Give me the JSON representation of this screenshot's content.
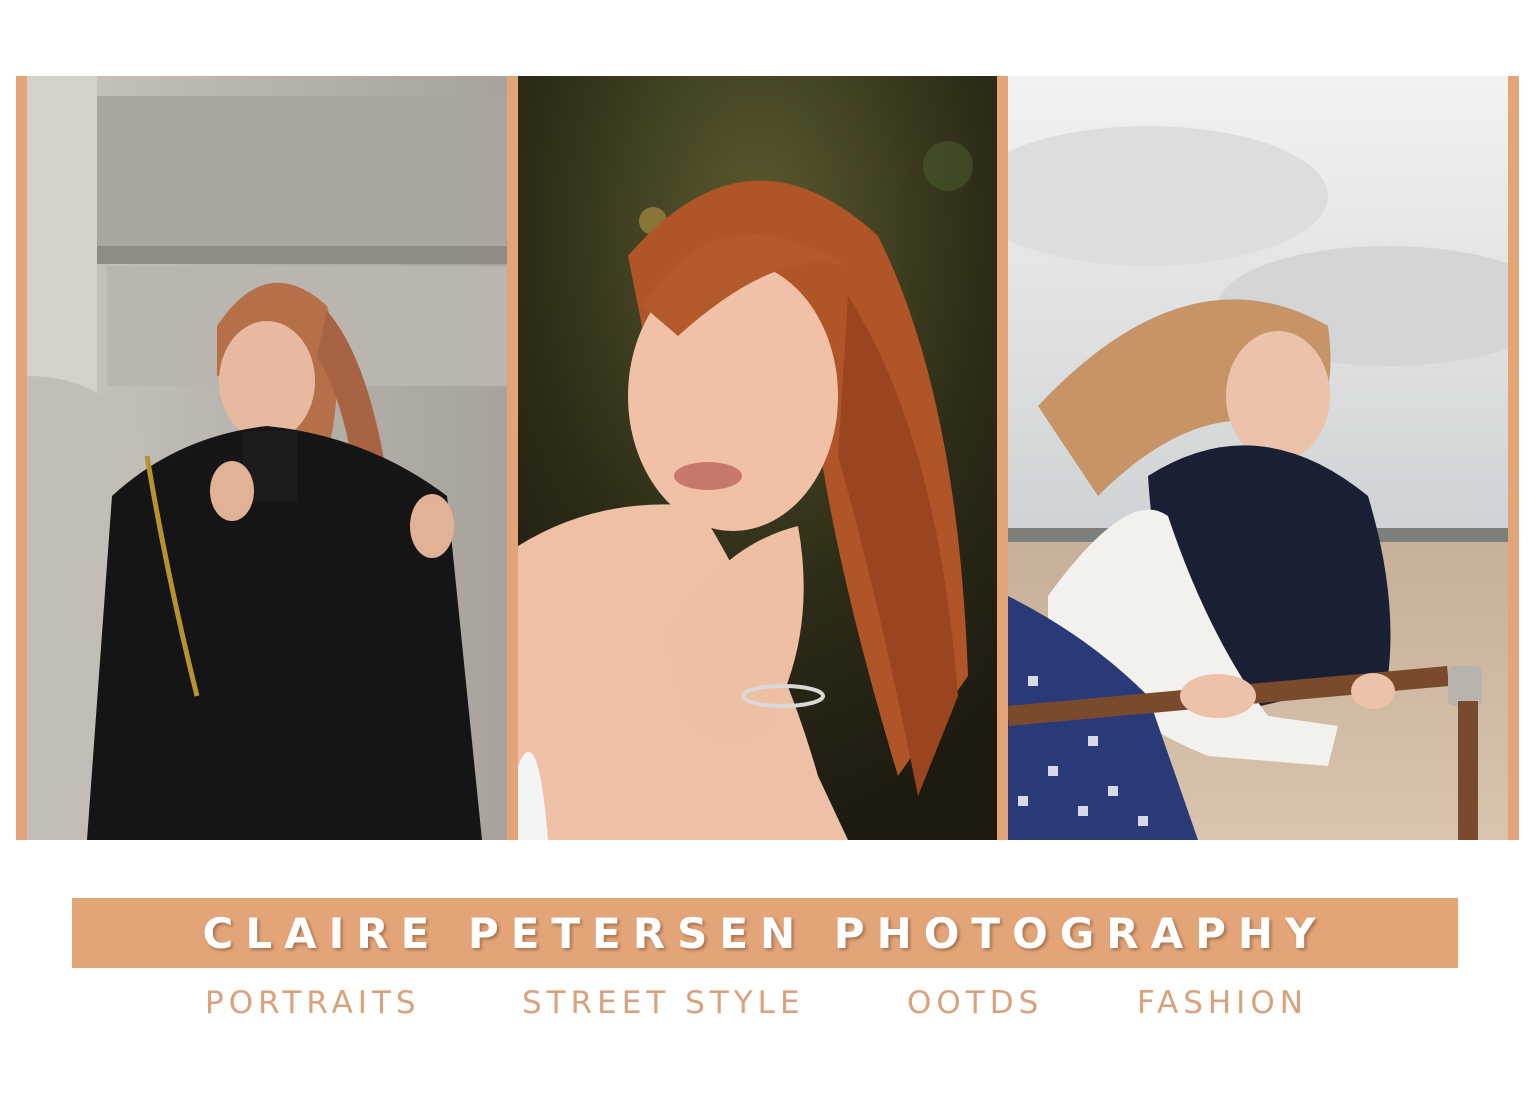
{
  "brand": {
    "title": "CLAIRE PETERSEN PHOTOGRAPHY",
    "accent_color": "#e3a578",
    "category_color": "#d9a27c"
  },
  "categories": [
    "PORTRAITS",
    "STREET STYLE",
    "OOTDS",
    "FASHION"
  ],
  "photos": [
    {
      "subject": "woman in black coat leaning against stone wall, holding ponytail"
    },
    {
      "subject": "close-up portrait of red-haired woman with hand on neck"
    },
    {
      "subject": "woman in black and white sweater leaning on rusty rail at beach"
    }
  ]
}
